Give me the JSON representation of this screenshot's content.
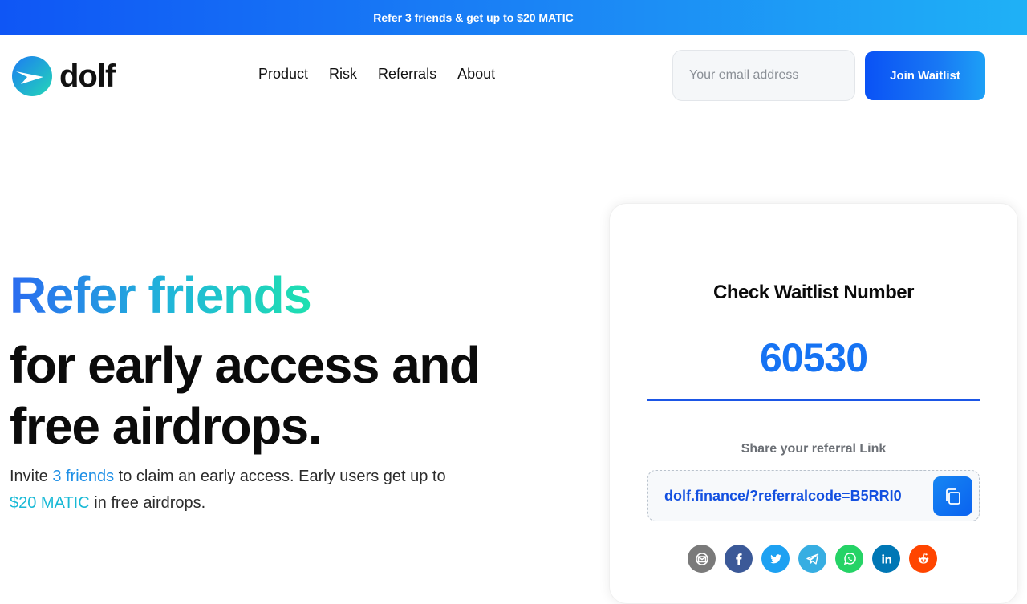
{
  "banner": {
    "text": "Refer 3 friends & get up to $20 MATIC"
  },
  "brand": {
    "name": "dolf"
  },
  "nav": {
    "items": [
      {
        "label": "Product"
      },
      {
        "label": "Risk"
      },
      {
        "label": "Referrals"
      },
      {
        "label": "About"
      }
    ]
  },
  "waitlist": {
    "email_placeholder": "Your email address",
    "email_value": "",
    "join_label": "Join Waitlist"
  },
  "hero": {
    "title_highlight": "Refer friends",
    "title_line2": "for early access and",
    "title_line3": "free airdrops.",
    "sub_part1": "Invite ",
    "sub_hl1": "3 friends",
    "sub_part2": " to claim an early access. Early users get up to ",
    "sub_hl2": "$20 MATIC",
    "sub_part3": " in free airdrops."
  },
  "card": {
    "title": "Check Waitlist Number",
    "number": "60530",
    "share_label": "Share your referral Link",
    "referral_link": "dolf.finance/?referralcode=B5RRI0"
  },
  "share_icons": [
    {
      "icon": "email-icon",
      "color": "#7a7a7a"
    },
    {
      "icon": "facebook-icon",
      "color": "#3b5998"
    },
    {
      "icon": "twitter-icon",
      "color": "#1da1f2"
    },
    {
      "icon": "telegram-icon",
      "color": "#37aee2"
    },
    {
      "icon": "whatsapp-icon",
      "color": "#25d366"
    },
    {
      "icon": "linkedin-icon",
      "color": "#0077b5"
    },
    {
      "icon": "reddit-icon",
      "color": "#ff4500"
    }
  ],
  "colors": {
    "accent": "#1673f3",
    "banner_start": "#0f56f5",
    "banner_end": "#1fb1f6"
  }
}
